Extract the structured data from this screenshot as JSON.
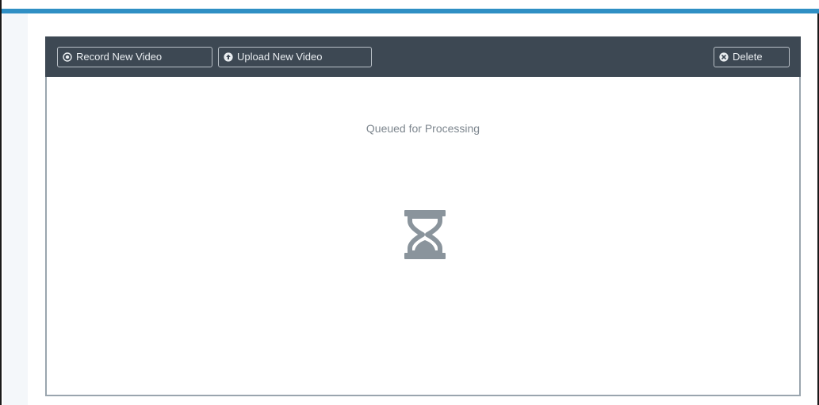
{
  "toolbar": {
    "record_label": "Record New Video",
    "upload_label": "Upload New Video",
    "delete_label": "Delete"
  },
  "status": {
    "message": "Queued for Processing"
  },
  "icons": {
    "record": "record-circle-icon",
    "upload": "upload-circle-icon",
    "delete": "delete-circle-icon",
    "status": "hourglass-icon"
  },
  "colors": {
    "accent": "#2f8fc4",
    "toolbar_bg": "#3d4853",
    "icon_gray": "#8a949c"
  }
}
